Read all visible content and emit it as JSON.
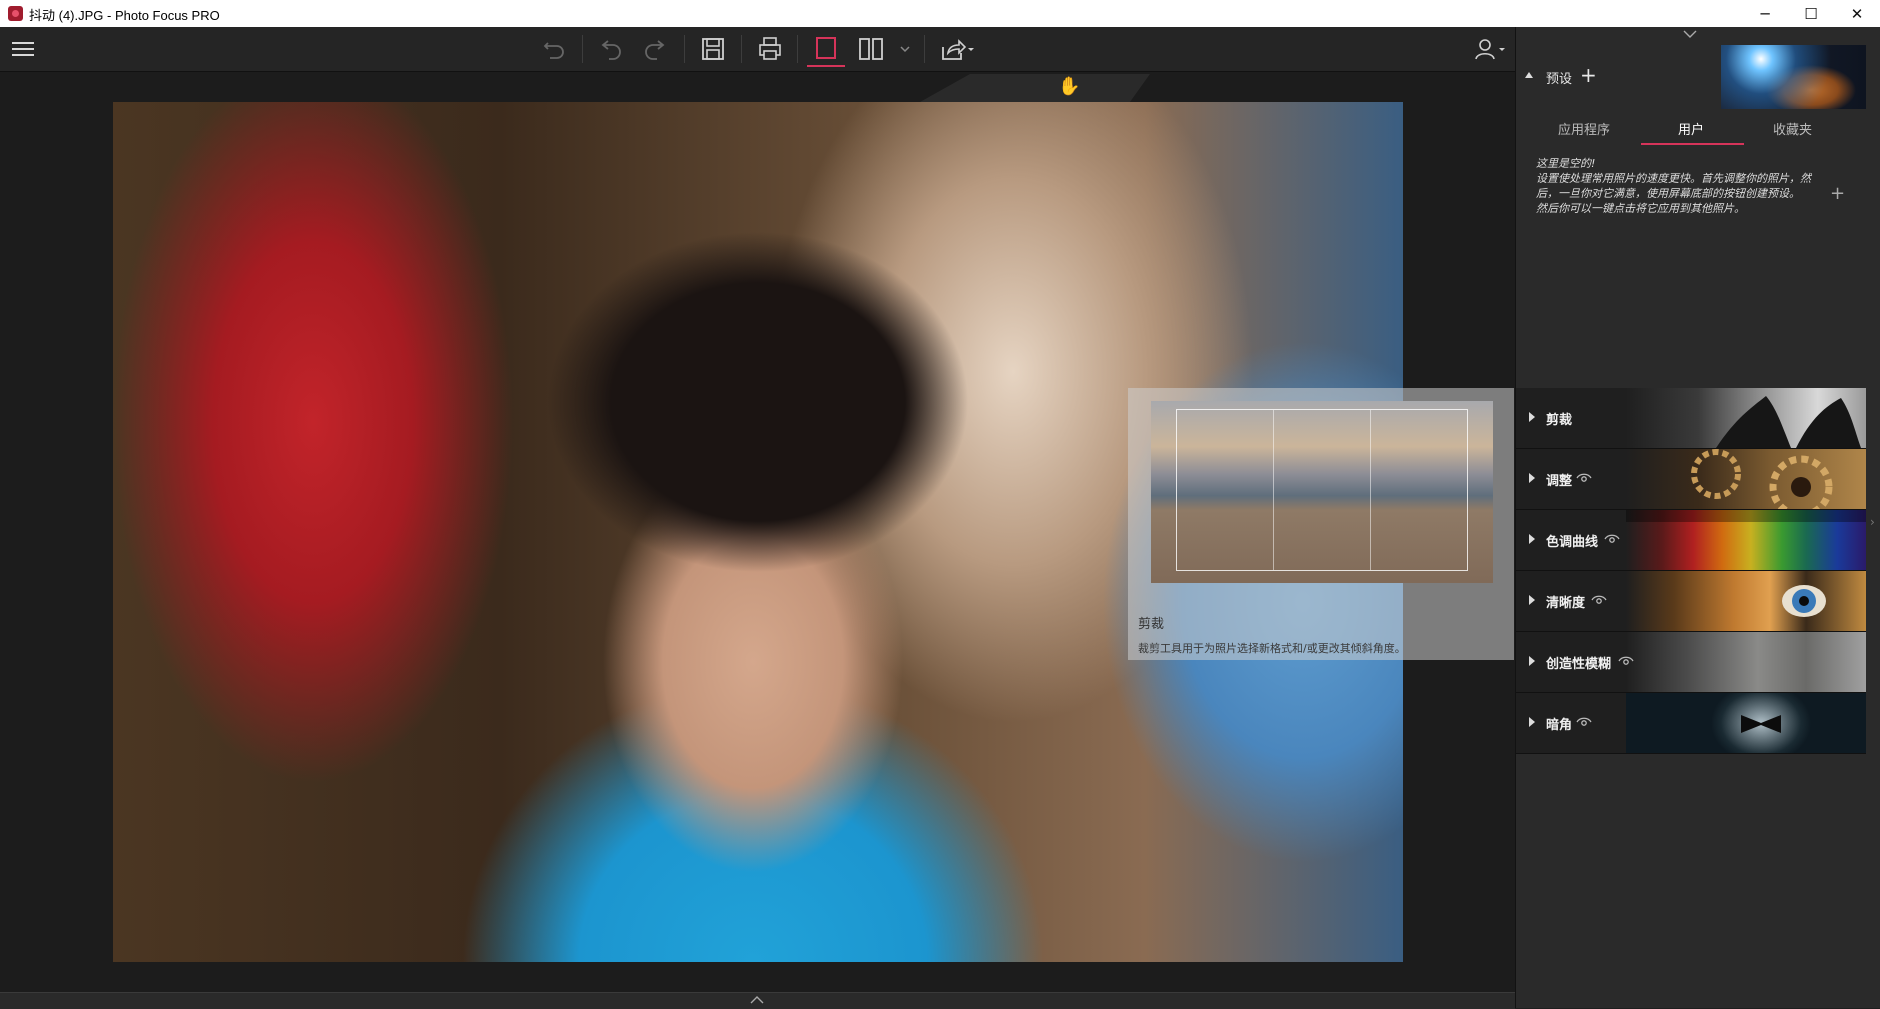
{
  "window": {
    "title": "抖动 (4).JPG - Photo Focus PRO",
    "buttons": {
      "minimize": "─",
      "maximize": "☐",
      "close": "✕"
    }
  },
  "toolbar": {
    "items": [
      "menu-icon",
      "undo-all-icon",
      "undo-icon",
      "redo-icon",
      "save-icon",
      "print-icon",
      "single-view-icon",
      "compare-view-icon",
      "chevron-down-icon",
      "share-icon",
      "user-icon"
    ],
    "accent_color": "#d6345a"
  },
  "sidebar": {
    "presets": {
      "label": "预设",
      "add": "+",
      "tabs": [
        "应用程序",
        "用户",
        "收藏夹"
      ],
      "active_tab": "用户",
      "empty_message_lines": [
        "这里是空的!",
        "设置使处理常用照片的速度更快。首先调整你的照片，然",
        "后，一旦你对它满意，使用屏幕底部的按钮创建预设。",
        "然后你可以一键点击将它应用到其他照片。"
      ]
    },
    "sections": [
      {
        "label": "剪裁",
        "has_eye": false
      },
      {
        "label": "调整",
        "has_eye": true
      },
      {
        "label": "色调曲线",
        "has_eye": true
      },
      {
        "label": "清晰度",
        "has_eye": true
      },
      {
        "label": "创造性模糊",
        "has_eye": true
      },
      {
        "label": "暗角",
        "has_eye": true
      }
    ]
  },
  "tooltip": {
    "title": "剪裁",
    "description": "裁剪工具用于为照片选择新格式和/或更改其倾斜角度。"
  }
}
